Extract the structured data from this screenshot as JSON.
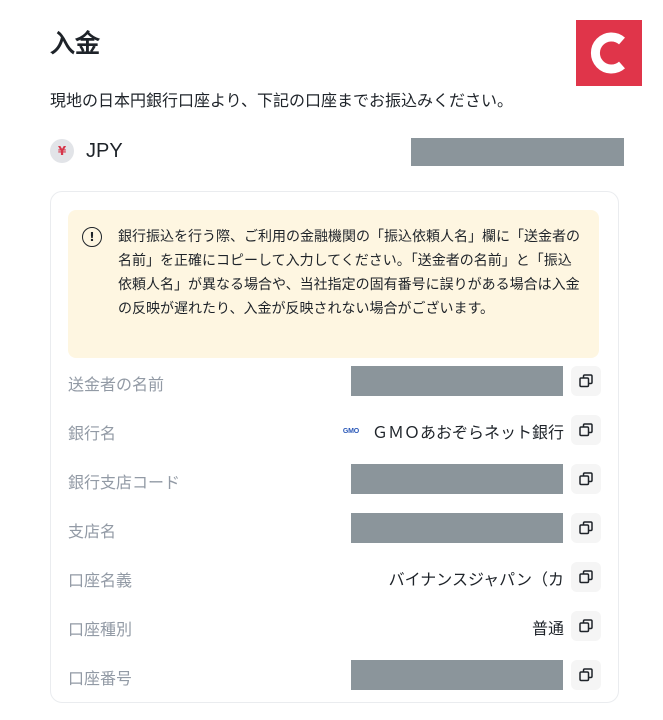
{
  "header": {
    "title": "入金",
    "subtitle": "現地の日本円銀行口座より、下記の口座までお振込みください。"
  },
  "currency": {
    "symbol": "¥",
    "code": "JPY"
  },
  "notice": {
    "icon": "!",
    "text": "銀行振込を行う際、ご利用の金融機関の「振込依頼人名」欄に「送金者の名前」を正確にコピーして入力してください。「送金者の名前」と「振込依頼人名」が異なる場合や、当社指定の固有番号に誤りがある場合は入金の反映が遅れたり、入金が反映されない場合がございます。"
  },
  "details": [
    {
      "label": "送金者の名前",
      "value": "",
      "redacted": true
    },
    {
      "label": "銀行名",
      "value": "ＧＭＯあおぞらネット銀行",
      "bank_icon": "GMO",
      "redacted": false
    },
    {
      "label": "銀行支店コード",
      "value": "",
      "redacted": true
    },
    {
      "label": "支店名",
      "value": "",
      "redacted": true
    },
    {
      "label": "口座名義",
      "value": "バイナンスジャパン（カ",
      "redacted": false
    },
    {
      "label": "口座種別",
      "value": "普通",
      "redacted": false
    },
    {
      "label": "口座番号",
      "value": "",
      "redacted": true
    }
  ],
  "icons": {
    "copy": "copy-icon",
    "notice": "info-circle-icon",
    "logo": "coincheck-logo"
  },
  "colors": {
    "logo_bg": "#e0354a",
    "notice_bg": "#fef6e1",
    "label": "#929aa5",
    "redaction": "#8b959b"
  }
}
